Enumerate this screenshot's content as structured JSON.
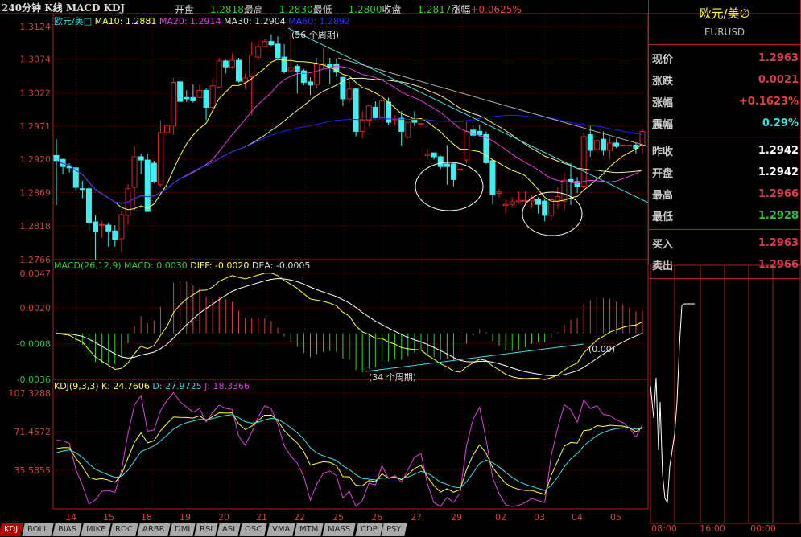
{
  "header": {
    "title": "240分钟 K线 MACD KDJ",
    "open_label": "开盘",
    "open": "1.2818",
    "high_label": "最高",
    "high": "1.2830",
    "low_label": "最低",
    "low": "1.2800",
    "close_label": "收盘",
    "close": "1.2817",
    "change_label": "涨幅",
    "change": "+0.0625%"
  },
  "legend": {
    "price": {
      "name": "欧元/美□",
      "ma10": "MA10: 1.2881",
      "ma20": "MA20: 1.2914",
      "ma30": "MA30: 1.2904",
      "ma60": "MA60: 1.2892"
    },
    "macd": {
      "name": "MACD(26,12,9)",
      "macd": "MACD: 0.0030",
      "diff": "DIFF: -0.0020",
      "dea": "DEA: -0.0005"
    },
    "kdj": {
      "name": "KDJ(9,3,3)",
      "k": "K: 24.7606",
      "d": "D: 27.9725",
      "j": "J: 18.3366"
    }
  },
  "annotations": {
    "period56": "(56 个周期)",
    "period34": "(34 个周期)",
    "zero": "(0.00)"
  },
  "colors": {
    "up": "#e02020",
    "down": "#40f0f0",
    "ma10": "#ffff40",
    "ma20": "#e040e0",
    "ma30": "#f0f0a0",
    "ma60": "#2020f0",
    "diff": "#ffff40",
    "dea": "#ffffff",
    "k": "#ffff40",
    "d": "#40e0e0",
    "j": "#e040e0",
    "trendline": "#40e0e0",
    "border": "#aa2222"
  },
  "sidebar": {
    "name": "欧元/美∅",
    "code": "EURUSD",
    "groups": [
      [
        {
          "label": "现价",
          "value": "1.2963",
          "color": "#d04050"
        },
        {
          "label": "涨跌",
          "value": "0.0021",
          "color": "#d04050"
        },
        {
          "label": "涨幅",
          "value": "+0.1623%",
          "color": "#e04040"
        },
        {
          "label": "震幅",
          "value": "0.29%",
          "color": "#40e0e0"
        }
      ],
      [
        {
          "label": "昨收",
          "value": "1.2942",
          "color": "#ffffff"
        },
        {
          "label": "开盘",
          "value": "1.2942",
          "color": "#ffffff"
        },
        {
          "label": "最高",
          "value": "1.2966",
          "color": "#d04050"
        },
        {
          "label": "最低",
          "value": "1.2928",
          "color": "#30c040"
        }
      ],
      [
        {
          "label": "买入",
          "value": "1.2963",
          "color": "#d04050"
        },
        {
          "label": "卖出",
          "value": "1.2966",
          "color": "#d04050"
        }
      ]
    ],
    "intraday_times": [
      "08:00",
      "16:00",
      "00:00"
    ]
  },
  "tabs": [
    "KDJ",
    "BOLL",
    "BIAS",
    "MIKE",
    "ROC",
    "ARBR",
    "DMI",
    "RSI",
    "ASI",
    "OSC",
    "VMA",
    "MTM",
    "MASS",
    "CDP",
    "PSY"
  ],
  "active_tab": "KDJ",
  "chart_data": {
    "type": "candlestick",
    "price_axis": {
      "ticks": [
        "1.3124",
        "1.3074",
        "1.3022",
        "1.2971",
        "1.2920",
        "1.2869",
        "1.2818",
        "1.2766"
      ],
      "ylim": [
        1.2766,
        1.3124
      ]
    },
    "macd_axis": {
      "ticks": [
        "0.0047",
        "0.0020",
        "-0.0008",
        "-0.0036"
      ],
      "ylim": [
        -0.0036,
        0.0047
      ]
    },
    "kdj_axis": {
      "ticks": [
        "107.3288",
        "71.4572",
        "35.5855"
      ]
    },
    "x_tick_labels": [
      "14",
      "15",
      "18",
      "19",
      "20",
      "21",
      "22",
      "25",
      "26",
      "27",
      "29",
      "02",
      "03",
      "04",
      "05"
    ],
    "grid": true,
    "ohlc_fields": [
      "open",
      "high",
      "low",
      "close"
    ],
    "candles": [
      [
        1.2926,
        1.2951,
        1.285,
        1.2918
      ],
      [
        1.292,
        1.2921,
        1.2897,
        1.2909
      ],
      [
        1.291,
        1.2914,
        1.29,
        1.2907
      ],
      [
        1.2907,
        1.2907,
        1.2872,
        1.2877
      ],
      [
        1.2875,
        1.2887,
        1.286,
        1.2874
      ],
      [
        1.2875,
        1.2878,
        1.281,
        1.2823
      ],
      [
        1.2824,
        1.2834,
        1.2766,
        1.2809
      ],
      [
        1.2819,
        1.2825,
        1.28,
        1.282
      ],
      [
        1.2819,
        1.2823,
        1.2786,
        1.281
      ],
      [
        1.281,
        1.2819,
        1.2786,
        1.2797
      ],
      [
        1.2798,
        1.284,
        1.2776,
        1.2835
      ],
      [
        1.2834,
        1.2882,
        1.282,
        1.2875
      ],
      [
        1.2877,
        1.294,
        1.2841,
        1.2924
      ],
      [
        1.2924,
        1.2928,
        1.2897,
        1.2919
      ],
      [
        1.2919,
        1.2928,
        1.284,
        1.284
      ],
      [
        1.2914,
        1.2918,
        1.2883,
        1.2886
      ],
      [
        1.2881,
        1.298,
        1.2878,
        1.2961
      ],
      [
        1.2961,
        1.2988,
        1.2956,
        1.2972
      ],
      [
        1.2971,
        1.3045,
        1.2957,
        1.3038
      ],
      [
        1.3039,
        1.3041,
        1.3007,
        1.3009
      ],
      [
        1.3015,
        1.3026,
        1.3008,
        1.3013
      ],
      [
        1.3015,
        1.3035,
        1.3007,
        1.301
      ],
      [
        1.3015,
        1.3035,
        1.3014,
        1.3026
      ],
      [
        1.3026,
        1.3029,
        1.298,
        1.3
      ],
      [
        1.3,
        1.3044,
        1.2992,
        1.3033
      ],
      [
        1.3031,
        1.3076,
        1.3029,
        1.3071
      ],
      [
        1.3071,
        1.3073,
        1.3052,
        1.3062
      ],
      [
        1.3062,
        1.3083,
        1.3059,
        1.3072
      ],
      [
        1.3072,
        1.3076,
        1.3038,
        1.304
      ],
      [
        1.3039,
        1.3052,
        1.3028,
        1.3045
      ],
      [
        1.3047,
        1.3101,
        1.2988,
        1.308
      ],
      [
        1.3077,
        1.3102,
        1.3072,
        1.3093
      ],
      [
        1.3093,
        1.3105,
        1.3093,
        1.3101
      ],
      [
        1.3101,
        1.3112,
        1.3094,
        1.3096
      ],
      [
        1.3097,
        1.3109,
        1.3072,
        1.3076
      ],
      [
        1.3077,
        1.3097,
        1.3052,
        1.3055
      ],
      [
        1.3056,
        1.3122,
        1.3054,
        1.3061
      ],
      [
        1.3063,
        1.3066,
        1.3021,
        1.3055
      ],
      [
        1.3056,
        1.3059,
        1.3034,
        1.3038
      ],
      [
        1.3039,
        1.3046,
        1.3019,
        1.3034
      ],
      [
        1.3035,
        1.3076,
        1.3029,
        1.3066
      ],
      [
        1.3065,
        1.3091,
        1.306,
        1.3067
      ],
      [
        1.3066,
        1.3076,
        1.3036,
        1.3062
      ],
      [
        1.3066,
        1.3075,
        1.3047,
        1.3054
      ],
      [
        1.3046,
        1.3047,
        1.3002,
        1.3013
      ],
      [
        1.3013,
        1.3042,
        1.3008,
        1.3028
      ],
      [
        1.3028,
        1.3029,
        1.2955,
        1.2963
      ],
      [
        1.2963,
        1.2994,
        1.2952,
        1.298
      ],
      [
        1.298,
        1.3002,
        1.2971,
        1.3002
      ],
      [
        1.3,
        1.3009,
        1.2983,
        1.2984
      ],
      [
        1.2984,
        1.3012,
        1.2978,
        1.301
      ],
      [
        1.3008,
        1.3015,
        1.2973,
        1.2977
      ],
      [
        1.2981,
        1.2988,
        1.2973,
        1.2982
      ],
      [
        1.2983,
        1.2994,
        1.2941,
        1.2963
      ],
      [
        1.2954,
        1.2977,
        1.2952,
        1.2977
      ],
      [
        1.298,
        1.2994,
        1.2971,
        1.2977
      ],
      [
        1.2975,
        1.2975,
        1.2975,
        1.2975
      ],
      [
        1.2926,
        1.2936,
        1.292,
        1.2928
      ],
      [
        1.293,
        1.293,
        1.292,
        1.2924
      ],
      [
        1.2924,
        1.2926,
        1.2905,
        1.2909
      ],
      [
        1.2913,
        1.2942,
        1.2881,
        1.2909
      ],
      [
        1.2913,
        1.2915,
        1.2879,
        1.2889
      ],
      [
        1.2904,
        1.2908,
        1.2903,
        1.2905
      ],
      [
        1.2919,
        1.298,
        1.2914,
        1.2963
      ],
      [
        1.2965,
        1.2972,
        1.2954,
        1.2957
      ],
      [
        1.2963,
        1.2973,
        1.2955,
        1.2958
      ],
      [
        1.2958,
        1.2963,
        1.2913,
        1.2915
      ],
      [
        1.2918,
        1.2919,
        1.2851,
        1.2866
      ],
      [
        1.2868,
        1.2875,
        1.2862,
        1.287
      ],
      [
        1.2849,
        1.2858,
        1.2837,
        1.2851
      ],
      [
        1.2851,
        1.2862,
        1.2846,
        1.2855
      ],
      [
        1.2855,
        1.2871,
        1.2852,
        1.2857
      ],
      [
        1.2857,
        1.2871,
        1.2851,
        1.2857
      ],
      [
        1.2856,
        1.2866,
        1.2846,
        1.286
      ],
      [
        1.2858,
        1.2862,
        1.2837,
        1.2851
      ],
      [
        1.2856,
        1.286,
        1.2825,
        1.2834
      ],
      [
        1.2834,
        1.2863,
        1.2825,
        1.2858
      ],
      [
        1.2856,
        1.2878,
        1.2844,
        1.2863
      ],
      [
        1.2856,
        1.2899,
        1.2842,
        1.2888
      ],
      [
        1.2889,
        1.2914,
        1.285,
        1.2886
      ],
      [
        1.2886,
        1.2893,
        1.2868,
        1.2878
      ],
      [
        1.2879,
        1.2961,
        1.2877,
        1.2955
      ],
      [
        1.2958,
        1.2971,
        1.2924,
        1.2934
      ],
      [
        1.2935,
        1.2955,
        1.2929,
        1.2949
      ],
      [
        1.2951,
        1.2963,
        1.2926,
        1.2934
      ],
      [
        1.2934,
        1.2955,
        1.292,
        1.2945
      ],
      [
        1.2945,
        1.2952,
        1.2937,
        1.294
      ],
      [
        1.2942,
        1.2942,
        1.2942,
        1.2942
      ],
      [
        1.2942,
        1.2942,
        1.2942,
        1.2942
      ],
      [
        1.2942,
        1.2946,
        1.2929,
        1.2937
      ],
      [
        1.2942,
        1.2966,
        1.2928,
        1.2963
      ]
    ],
    "indicators": {
      "ma_periods": [
        10,
        20,
        30,
        60
      ],
      "macd_params": [
        26,
        12,
        9
      ],
      "kdj_params": [
        9,
        3,
        3
      ]
    }
  }
}
